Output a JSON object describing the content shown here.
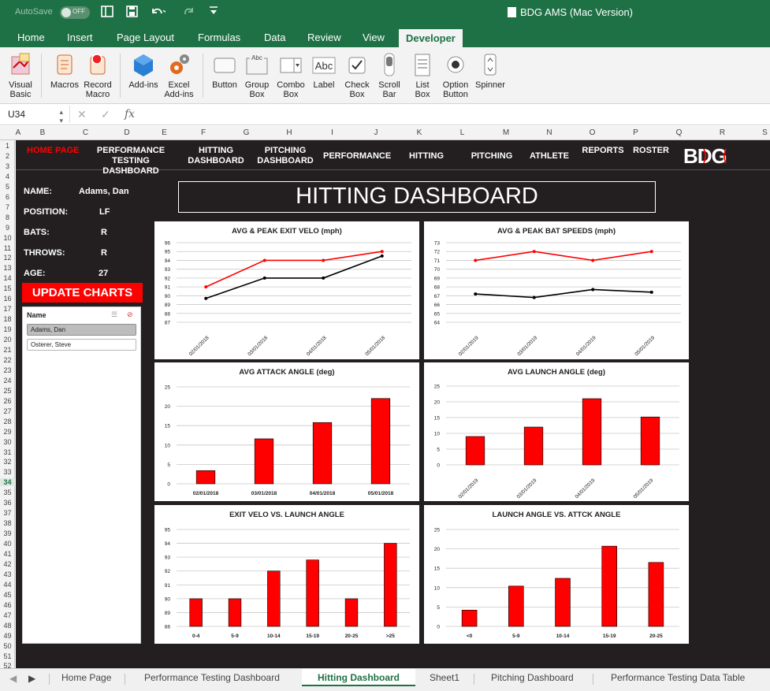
{
  "titlebar": {
    "autosave_label": "AutoSave",
    "autosave_state": "OFF",
    "doc_title": "BDG AMS (Mac Version)"
  },
  "ribbon_tabs": [
    "Home",
    "Insert",
    "Page Layout",
    "Formulas",
    "Data",
    "Review",
    "View",
    "Developer"
  ],
  "ribbon": {
    "visual_basic": [
      "Visual",
      "Basic"
    ],
    "macros": "Macros",
    "record_macro": [
      "Record",
      "Macro"
    ],
    "add_ins": "Add-ins",
    "excel_add_ins": [
      "Excel",
      "Add-ins"
    ],
    "button": "Button",
    "group_box": [
      "Group",
      "Box"
    ],
    "combo_box": [
      "Combo",
      "Box"
    ],
    "label": "Label",
    "check_box": [
      "Check",
      "Box"
    ],
    "scroll_bar": [
      "Scroll",
      "Bar"
    ],
    "list_box": [
      "List",
      "Box"
    ],
    "option_button": [
      "Option",
      "Button"
    ],
    "spinner": "Spinner",
    "label_icon_text": "Abc",
    "group_box_icon_text": "Abc"
  },
  "formula_bar": {
    "name_box": "U34",
    "fx": "fx",
    "value": ""
  },
  "columns": [
    "A",
    "B",
    "C",
    "D",
    "E",
    "F",
    "G",
    "H",
    "I",
    "J",
    "K",
    "L",
    "M",
    "N",
    "O",
    "P",
    "Q",
    "R",
    "S"
  ],
  "rows": [
    "1",
    "2",
    "3",
    "4",
    "5",
    "6",
    "7",
    "8",
    "9",
    "10",
    "11",
    "12",
    "13",
    "14",
    "15",
    "16",
    "17",
    "18",
    "19",
    "20",
    "21",
    "22",
    "23",
    "24",
    "25",
    "26",
    "27",
    "28",
    "29",
    "30",
    "31",
    "32",
    "33",
    "34",
    "35",
    "36",
    "37",
    "38",
    "39",
    "40",
    "41",
    "42",
    "43",
    "44",
    "45",
    "46",
    "47",
    "48",
    "49",
    "50",
    "51",
    "52"
  ],
  "active_row": "34",
  "nav": {
    "home": "HOME PAGE",
    "perf_testing": [
      "PERFORMANCE",
      "TESTING DASHBOARD"
    ],
    "hitting": [
      "HITTING",
      "DASHBOARD"
    ],
    "pitching": [
      "PITCHING",
      "DASHBOARD"
    ],
    "performance": "PERFORMANCE",
    "hitting2": "HITTING",
    "pitching2": "PITCHING",
    "athlete": "ATHLETE",
    "reports": "REPORTS",
    "roster": "ROSTER",
    "logo_text": "BDG"
  },
  "player": {
    "name_label": "NAME:",
    "name": "Adams, Dan",
    "position_label": "POSITION:",
    "position": "LF",
    "bats_label": "BATS:",
    "bats": "R",
    "throws_label": "THROWS:",
    "throws": "R",
    "age_label": "AGE:",
    "age": "27"
  },
  "update_button": "UPDATE CHARTS",
  "slicer": {
    "title": "Name",
    "items": [
      "Adams, Dan",
      "Osterer, Steve"
    ],
    "selected": "Adams, Dan"
  },
  "dashboard_title": "HITTING DASHBOARD",
  "colors": {
    "red": "#ff0000",
    "black": "#000000",
    "excel_green": "#1e7145",
    "sheet_bg": "#231f20"
  },
  "chart_data": [
    {
      "id": "exit_velo",
      "type": "line",
      "title": "AVG & PEAK EXIT VELO (mph)",
      "categories": [
        "02/01/2018",
        "03/01/2018",
        "04/01/2018",
        "05/01/2018"
      ],
      "series": [
        {
          "color": "#ff0000",
          "values": [
            91,
            94,
            94,
            95
          ]
        },
        {
          "color": "#000000",
          "values": [
            89.7,
            92,
            92,
            94.5
          ]
        }
      ],
      "ylim": [
        87,
        96
      ],
      "yticks": [
        "87",
        "88",
        "89",
        "90",
        "91",
        "92",
        "93",
        "94",
        "95",
        "96"
      ],
      "grid": true
    },
    {
      "id": "bat_speed",
      "type": "line",
      "title": "AVG & PEAK BAT SPEEDS (mph)",
      "categories": [
        "02/01/2019",
        "03/01/2019",
        "04/01/2019",
        "05/01/2019"
      ],
      "series": [
        {
          "color": "#ff0000",
          "values": [
            71,
            72,
            71,
            72
          ]
        },
        {
          "color": "#000000",
          "values": [
            67.2,
            66.8,
            67.7,
            67.4
          ]
        }
      ],
      "ylim": [
        64,
        73
      ],
      "yticks": [
        "64",
        "65",
        "66",
        "67",
        "68",
        "69",
        "70",
        "71",
        "72",
        "73"
      ],
      "grid": true
    },
    {
      "id": "attack_angle",
      "type": "bar",
      "title": "AVG ATTACK ANGLE (deg)",
      "categories": [
        "02/01/2018",
        "03/01/2018",
        "04/01/2018",
        "05/01/2018"
      ],
      "values": [
        3.4,
        11.6,
        15.8,
        22
      ],
      "ylim": [
        0,
        25
      ],
      "yticks": [
        "0",
        "5",
        "10",
        "15",
        "20",
        "25"
      ],
      "grid": true,
      "rotate_labels": false
    },
    {
      "id": "launch_angle",
      "type": "bar",
      "title": "AVG LAUNCH ANGLE (deg)",
      "categories": [
        "02/01/2019",
        "03/01/2019",
        "04/01/2019",
        "05/01/2019"
      ],
      "values": [
        9,
        12,
        21,
        15.2
      ],
      "ylim": [
        0,
        25
      ],
      "yticks": [
        "0",
        "5",
        "10",
        "15",
        "20",
        "25"
      ],
      "grid": true,
      "rotate_labels": true
    },
    {
      "id": "ev_vs_la",
      "type": "bar",
      "title": "EXIT VELO VS. LAUNCH ANGLE",
      "categories": [
        "0-4",
        "5-9",
        "10-14",
        "15-19",
        "20-25",
        ">25"
      ],
      "values": [
        90,
        90,
        92,
        92.8,
        90,
        94
      ],
      "ylim": [
        88,
        95
      ],
      "yticks": [
        "88",
        "89",
        "90",
        "91",
        "92",
        "93",
        "94",
        "95"
      ],
      "grid": true,
      "rotate_labels": false
    },
    {
      "id": "la_vs_aa",
      "type": "bar",
      "title": "LAUNCH ANGLE VS. ATTCK ANGLE",
      "categories": [
        "<0",
        "5-9",
        "10-14",
        "15-19",
        "20-25"
      ],
      "values": [
        4.2,
        10.4,
        12.4,
        20.7,
        16.5
      ],
      "ylim": [
        0,
        25
      ],
      "yticks": [
        "0",
        "5",
        "10",
        "15",
        "20",
        "25"
      ],
      "grid": true,
      "rotate_labels": false
    }
  ],
  "sheet_tabs": [
    "Home Page",
    "Performance Testing Dashboard",
    "Hitting Dashboard",
    "Sheet1",
    "Pitching Dashboard",
    "Performance Testing Data Table"
  ],
  "active_sheet": "Hitting Dashboard"
}
